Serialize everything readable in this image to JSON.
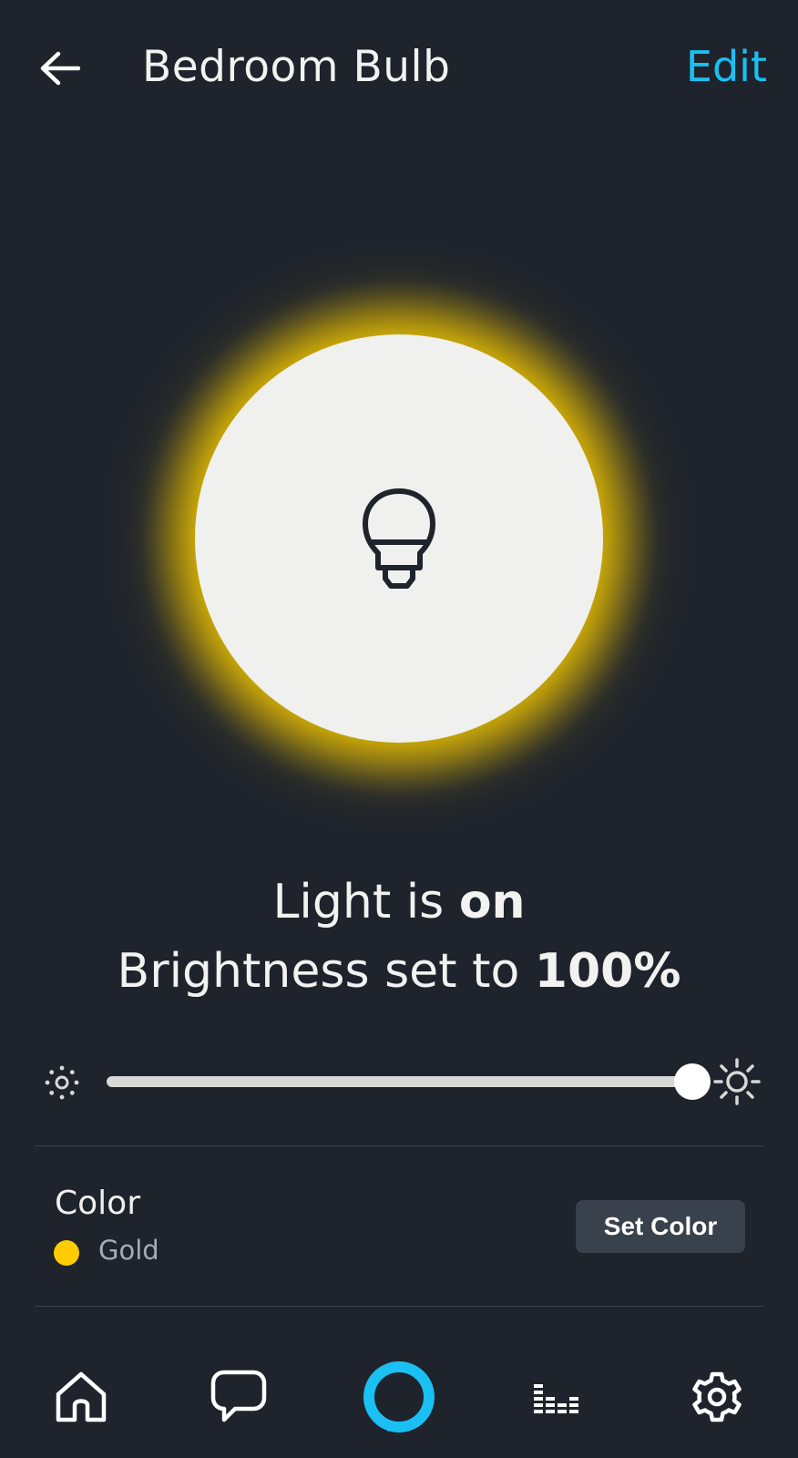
{
  "header": {
    "back_icon": "arrow-left-icon",
    "title": "Bedroom Bulb",
    "edit_label": "Edit"
  },
  "device": {
    "icon": "lightbulb-icon",
    "glow_color": "#e6be0a",
    "status_prefix": "Light is ",
    "status_value": "on",
    "brightness_prefix": "Brightness set to ",
    "brightness_value": "100%",
    "brightness_level": 100
  },
  "slider": {
    "min_icon": "sun-dim-icon",
    "max_icon": "sun-bright-icon"
  },
  "color": {
    "label": "Color",
    "name": "Gold",
    "swatch": "#ffcc00",
    "button_label": "Set Color"
  },
  "nav": {
    "items": [
      {
        "icon": "home-icon"
      },
      {
        "icon": "chat-bubble-icon"
      },
      {
        "icon": "alexa-ring-icon"
      },
      {
        "icon": "equalizer-icon"
      },
      {
        "icon": "gear-icon"
      }
    ]
  },
  "colors": {
    "background": "#1e232c",
    "accent": "#1ac0f2",
    "button_bg": "#39414c"
  }
}
